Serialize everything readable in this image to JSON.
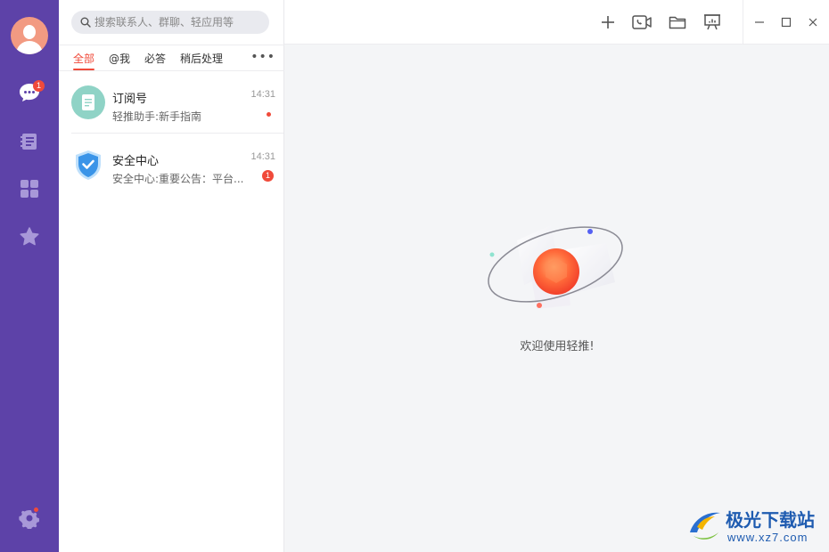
{
  "rail": {
    "chat_badge": "1",
    "colors": {
      "background": "#5d42a8",
      "badge": "#f04a3a"
    }
  },
  "search": {
    "placeholder": "搜索联系人、群聊、轻应用等"
  },
  "tabs": [
    {
      "label": "全部"
    },
    {
      "label": "@我"
    },
    {
      "label": "必答"
    },
    {
      "label": "稍后处理"
    }
  ],
  "conversations": [
    {
      "name": "订阅号",
      "preview": "轻推助手:新手指南",
      "time": "14:31",
      "icon": "document-icon"
    },
    {
      "name": "安全中心",
      "preview": "安全中心:重要公告：平台...",
      "time": "14:31",
      "badge": "1",
      "icon": "shield-icon"
    }
  ],
  "main": {
    "welcome": "欢迎使用轻推!"
  },
  "watermark": {
    "text": "极光下载站",
    "url": "www.xz7.com"
  }
}
